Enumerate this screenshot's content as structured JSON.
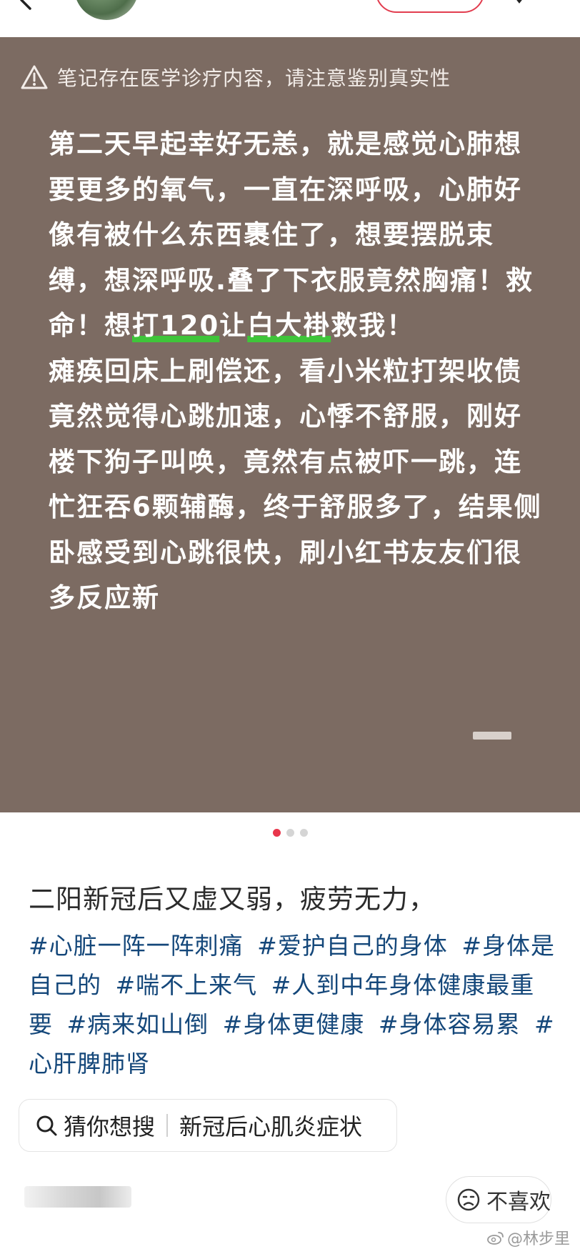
{
  "warning": {
    "text": "笔记存在医学诊疗内容，请注意鉴别真实性"
  },
  "note_image": {
    "p1_a": "第二天早起幸好无恙，就是感觉心肺想要更多的氧气，一直在深呼吸，心肺好像有被什么东西裹住了，想要摆脱束缚，想深呼吸.叠了下衣服竟然胸痛！救命！想",
    "p1_hl1": "打120",
    "p1_b": "让",
    "p1_hl2": "白大褂",
    "p1_c": "救我！",
    "p2": "瘫痪回床上刷偿还，看小米粒打架收债竟然觉得心跳加速，心悸不舒服，刚好楼下狗子叫唤，竟然有点被吓一跳，连忙狂吞6颗辅酶，终于舒服多了，结果侧卧感受到心跳很快，刷小红书友友们很多反应新"
  },
  "pagination": {
    "count": 3,
    "active_index": 0
  },
  "post": {
    "title": "二阳新冠后又虚又弱，疲劳无力，",
    "tags": [
      "#心脏一阵一阵刺痛",
      "#爱护自己的身体",
      "#身体是自己的",
      "#喘不上来气",
      "#人到中年身体健康最重要",
      "#病来如山倒",
      "#身体更健康",
      "#身体容易累",
      "#心肝脾肺肾"
    ]
  },
  "search_chip": {
    "label": "猜你想搜",
    "suggestion": "新冠后心肌炎症状"
  },
  "actions": {
    "dislike_label": "不喜欢"
  },
  "watermark": {
    "text": "@林步里"
  },
  "colors": {
    "card_bg": "#7c6b62",
    "accent": "#e8364b",
    "tag": "#14477a",
    "highlight": "#3fc53a"
  }
}
